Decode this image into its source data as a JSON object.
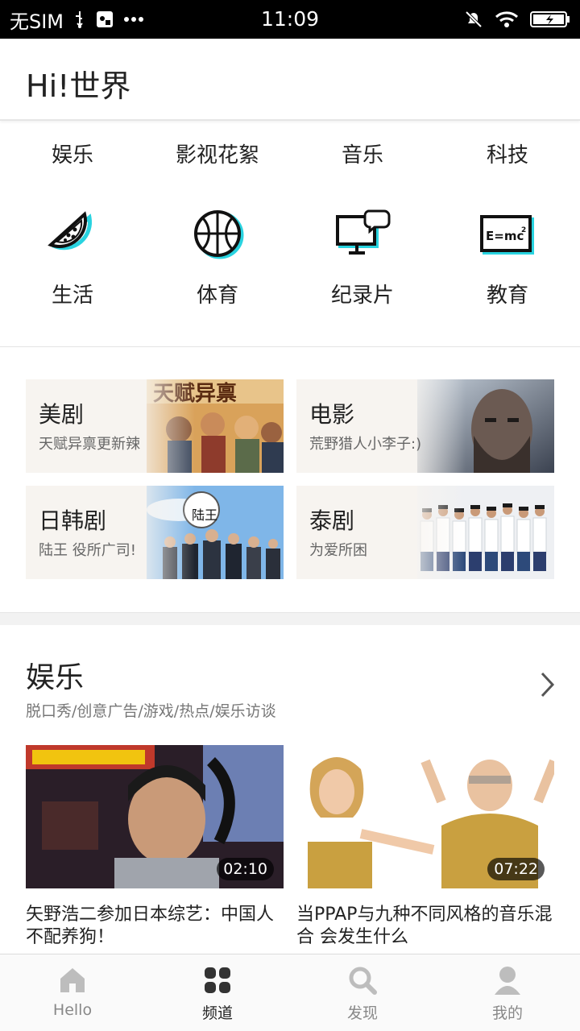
{
  "status_bar": {
    "carrier": "无SIM",
    "time": "11:09"
  },
  "header": {
    "title": "Hi!世界"
  },
  "categories_text": [
    "娱乐",
    "影视花絮",
    "音乐",
    "科技"
  ],
  "categories_icon": [
    {
      "label": "生活",
      "icon": "watermelon-icon"
    },
    {
      "label": "体育",
      "icon": "basketball-icon"
    },
    {
      "label": "纪录片",
      "icon": "monitor-chat-icon"
    },
    {
      "label": "教育",
      "icon": "blackboard-emc2-icon"
    }
  ],
  "featured": [
    {
      "title": "美剧",
      "subtitle": "天赋异禀更新辣",
      "art_text": "天赋异禀"
    },
    {
      "title": "电影",
      "subtitle": "荒野猎人小李子:)"
    },
    {
      "title": "日韩剧",
      "subtitle": "陆王 役所广司!",
      "art_text": "陆王"
    },
    {
      "title": "泰剧",
      "subtitle": "为爱所困"
    }
  ],
  "section": {
    "title": "娱乐",
    "subtitle": "脱口秀/创意广告/游戏/热点/娱乐访谈",
    "videos": [
      {
        "duration": "02:10",
        "title": "矢野浩二参加日本综艺：中国人不配养狗！"
      },
      {
        "duration": "07:22",
        "title": "当PPAP与九种不同风格的音乐混合 会发生什么"
      }
    ]
  },
  "tab_bar": {
    "items": [
      {
        "label": "Hello",
        "icon": "home-icon"
      },
      {
        "label": "频道",
        "icon": "grid-icon"
      },
      {
        "label": "发现",
        "icon": "search-icon"
      },
      {
        "label": "我的",
        "icon": "user-icon"
      }
    ],
    "active": "频道"
  },
  "colors": {
    "accent_cyan": "#29d3e0",
    "text": "#222222",
    "muted": "#777777"
  }
}
